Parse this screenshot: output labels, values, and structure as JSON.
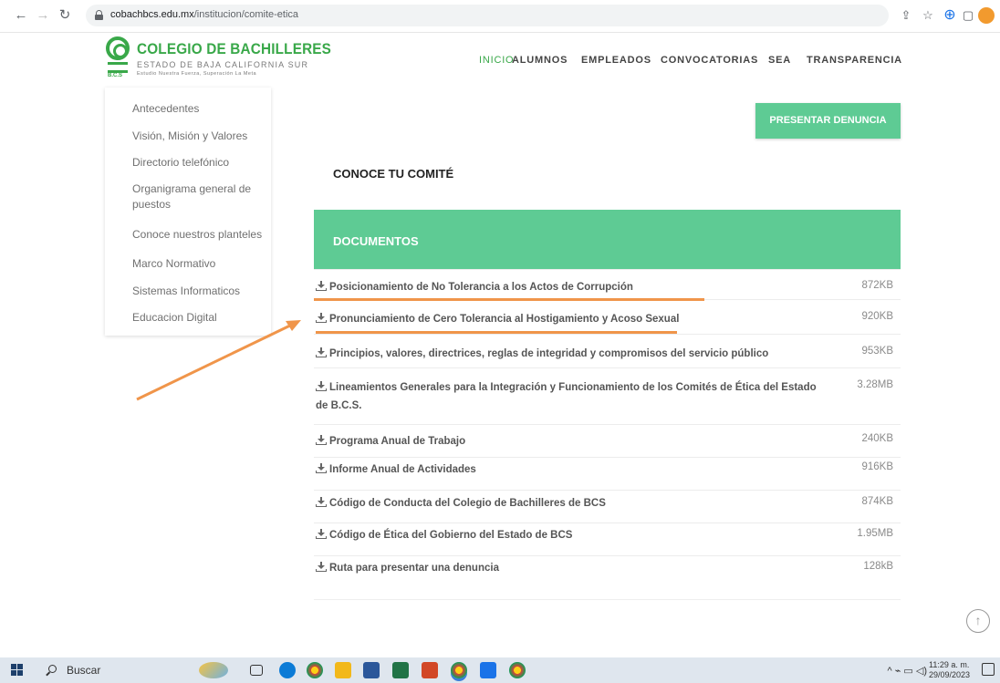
{
  "browser": {
    "url_host": "cobachbcs.edu.mx",
    "url_path": "/institucion/comite-etica"
  },
  "header": {
    "logo_title": "COLEGIO DE BACHILLERES",
    "logo_subtitle": "ESTADO DE BAJA CALIFORNIA SUR",
    "logo_motto": "Estudio Nuestra Fuerza, Superación La Meta",
    "logo_bcs": "B.C.S",
    "nav": [
      "INICIO",
      "ALUMNOS",
      "EMPLEADOS",
      "CONVOCATORIAS",
      "SEA",
      "TRANSPARENCIA"
    ]
  },
  "sidebar": {
    "items": [
      "Antecedentes",
      "Visión, Misión y Valores",
      "Directorio telefónico",
      "Organigrama general de puestos",
      "Conoce nuestros planteles",
      "Marco Normativo",
      "Sistemas Informaticos",
      "Educacion Digital"
    ]
  },
  "main": {
    "denuncia_button": "PRESENTAR DENUNCIA",
    "section_title": "CONOCE TU COMITÉ",
    "docs_header": "DOCUMENTOS",
    "documents": [
      {
        "title": "Posicionamiento de No Tolerancia a los Actos de Corrupción",
        "size": "872KB"
      },
      {
        "title": "Pronunciamiento de Cero Tolerancia al Hostigamiento y Acoso Sexual",
        "size": "920KB"
      },
      {
        "title": "Principios, valores, directrices, reglas de integridad y compromisos del servicio público",
        "size": "953KB"
      },
      {
        "title": "Lineamientos Generales para la Integración y Funcionamiento de los Comités de Ética del Estado de B.C.S.",
        "size": "3.28MB"
      },
      {
        "title": "Programa Anual de Trabajo",
        "size": "240KB"
      },
      {
        "title": "Informe Anual de Actividades",
        "size": "916KB"
      },
      {
        "title": "Código de Conducta del Colegio de Bachilleres de BCS",
        "size": "874KB"
      },
      {
        "title": "Código de Ética del Gobierno del Estado de BCS",
        "size": "1.95MB"
      },
      {
        "title": "Ruta para presentar una denuncia",
        "size": "128kB"
      }
    ]
  },
  "taskbar": {
    "search_label": "Buscar",
    "time": "11:29 a. m.",
    "date": "29/09/2023"
  },
  "colors": {
    "accent_green": "#5ecb94",
    "brand_green": "#39a849",
    "annotation_orange": "#f0954a"
  }
}
